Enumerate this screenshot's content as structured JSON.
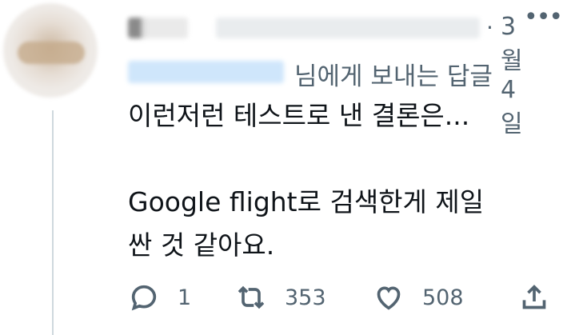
{
  "tweet": {
    "date": "3월 4일",
    "separator": "·",
    "more_glyph": "•••",
    "reply_prefix": "님에게 보내는 답글",
    "lines": [
      "이런저런 테스트로 낸 결론은...",
      "Google flight로 검색한게 제일",
      "싼 것 같아요."
    ]
  },
  "actions": {
    "replies": "1",
    "retweets": "353",
    "likes": "508"
  },
  "colors": {
    "text": "#0f1419",
    "muted": "#536471",
    "thread_line": "#cfd9de"
  }
}
